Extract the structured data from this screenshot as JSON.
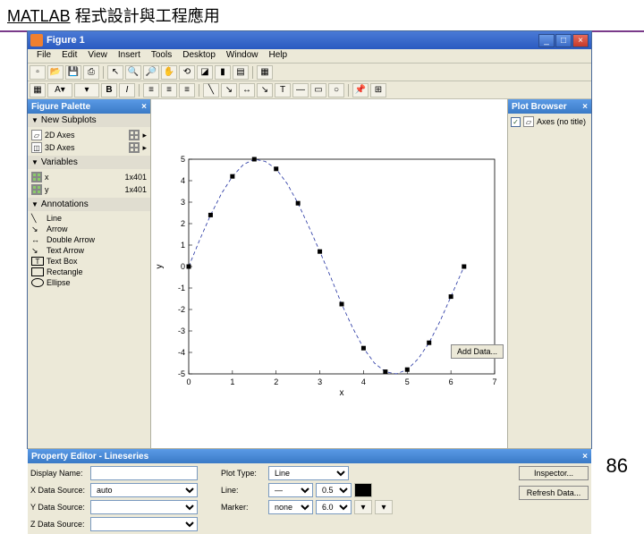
{
  "slide": {
    "title_prefix": "MATLAB",
    "title_rest": " 程式設計與工程應用",
    "page": "86"
  },
  "window": {
    "title": "Figure 1",
    "menus": [
      "File",
      "Edit",
      "View",
      "Insert",
      "Tools",
      "Desktop",
      "Window",
      "Help"
    ]
  },
  "figure_palette": {
    "header": "Figure Palette",
    "new_subplots": "New Subplots",
    "axes2d": "2D Axes",
    "axes3d": "3D Axes",
    "variables": "Variables",
    "var_x": "x",
    "var_x_size": "1x401",
    "var_y": "y",
    "var_y_size": "1x401",
    "annotations": "Annotations",
    "ann_line": "Line",
    "ann_arrow": "Arrow",
    "ann_darrow": "Double Arrow",
    "ann_tarrow": "Text Arrow",
    "ann_tbox": "Text Box",
    "ann_rect": "Rectangle",
    "ann_ell": "Ellipse"
  },
  "plot_browser": {
    "header": "Plot Browser",
    "item": "Axes (no title)"
  },
  "add_data_btn": "Add Data...",
  "prop_editor": {
    "header": "Property Editor - Lineseries",
    "display_name": "Display Name:",
    "x_src": "X Data Source:",
    "x_src_val": "auto",
    "y_src": "Y Data Source:",
    "z_src": "Z Data Source:",
    "plot_type": "Plot Type:",
    "plot_type_val": "Line",
    "line": "Line:",
    "line_width": "0.5",
    "marker": "Marker:",
    "marker_val": "none",
    "marker_size": "6.0",
    "inspector": "Inspector...",
    "refresh": "Refresh Data..."
  },
  "chart_data": {
    "type": "line",
    "title": "",
    "xlabel": "x",
    "ylabel": "y",
    "xlim": [
      0,
      7
    ],
    "ylim": [
      -5,
      5
    ],
    "xticks": [
      0,
      1,
      2,
      3,
      4,
      5,
      6,
      7
    ],
    "yticks": [
      -5,
      -4,
      -3,
      -2,
      -1,
      0,
      1,
      2,
      3,
      4,
      5
    ],
    "marker_x": [
      0,
      0.5,
      1,
      1.5,
      2,
      2.5,
      3,
      3.5,
      4,
      4.5,
      5,
      5.5,
      6,
      6.3
    ],
    "marker_y": [
      0,
      2.4,
      4.2,
      5.0,
      4.55,
      2.95,
      0.7,
      -1.75,
      -3.8,
      -4.9,
      -4.8,
      -3.55,
      -1.4,
      0
    ],
    "series": [
      {
        "name": "y",
        "x": [
          0,
          0.25,
          0.5,
          0.75,
          1,
          1.25,
          1.5,
          1.75,
          2,
          2.25,
          2.5,
          2.75,
          3,
          3.25,
          3.5,
          3.75,
          4,
          4.25,
          4.5,
          4.75,
          5,
          5.25,
          5.5,
          5.75,
          6,
          6.3
        ],
        "y": [
          0,
          1.24,
          2.4,
          3.4,
          4.2,
          4.75,
          5.0,
          4.9,
          4.55,
          3.87,
          2.95,
          1.85,
          0.7,
          -0.5,
          -1.75,
          -2.85,
          -3.8,
          -4.5,
          -4.9,
          -5.0,
          -4.8,
          -4.3,
          -3.55,
          -2.55,
          -1.4,
          0
        ]
      }
    ]
  }
}
